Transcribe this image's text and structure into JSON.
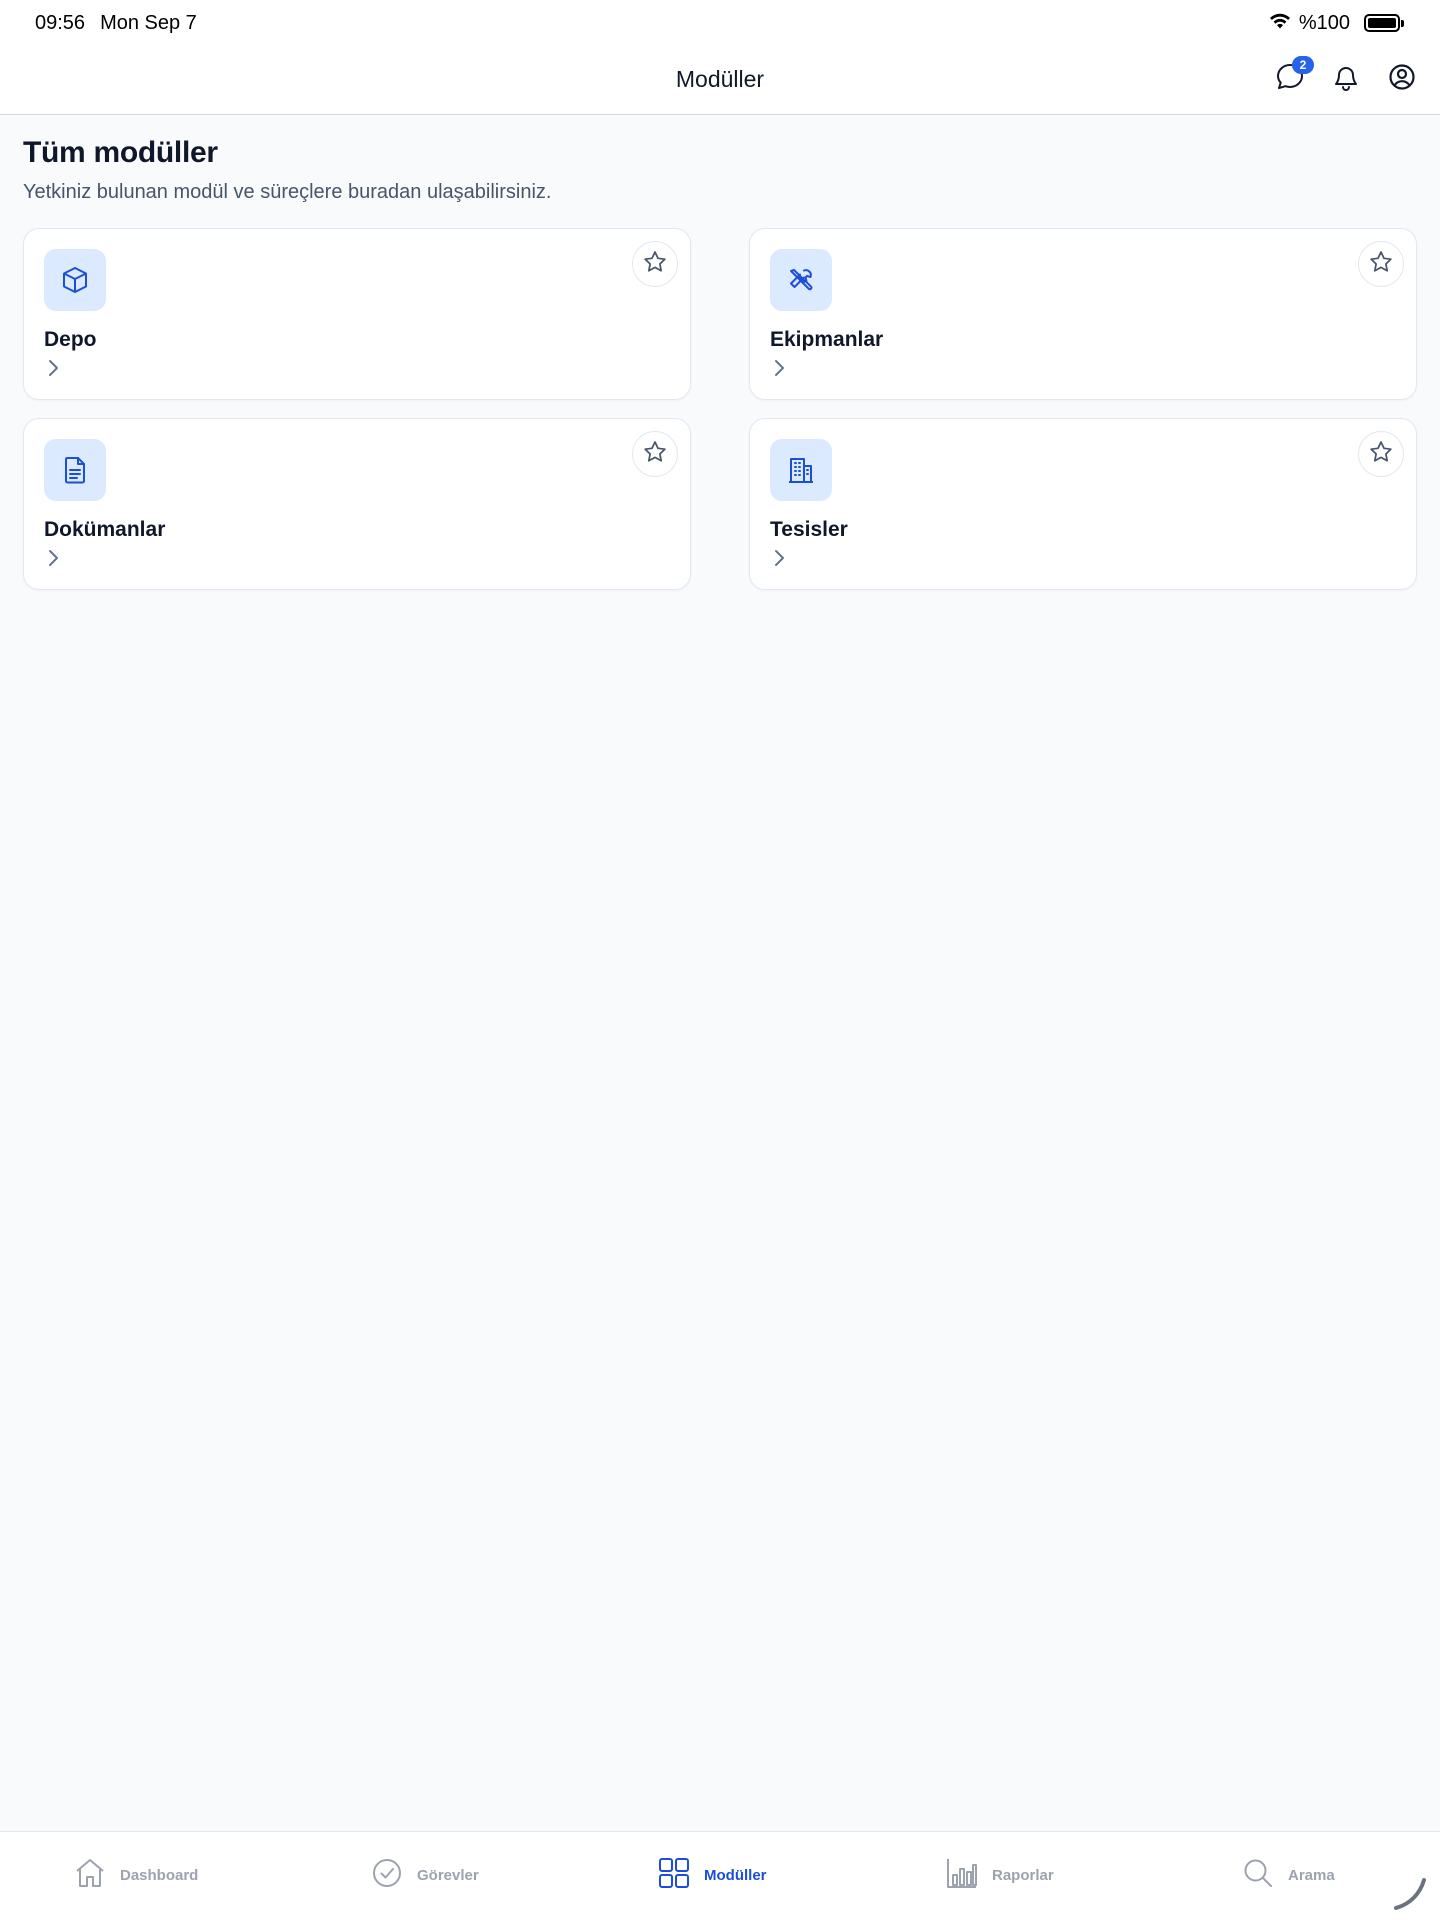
{
  "status_bar": {
    "time": "09:56",
    "date": "Mon Sep 7",
    "battery": "%100"
  },
  "nav": {
    "title": "Modüller",
    "messages_badge": "2",
    "icons": [
      "chat-icon",
      "bell-icon",
      "user-circle-icon"
    ]
  },
  "page": {
    "heading": "Tüm modüller",
    "subtitle": "Yetkiniz bulunan modül ve süreçlere buradan ulaşabilirsiniz."
  },
  "modules": [
    {
      "title": "Depo",
      "icon": "box-icon"
    },
    {
      "title": "Ekipmanlar",
      "icon": "tools-icon"
    },
    {
      "title": "Dokümanlar",
      "icon": "document-icon"
    },
    {
      "title": "Tesisler",
      "icon": "building-icon"
    }
  ],
  "tabs": [
    {
      "label": "Dashboard",
      "icon": "home-icon",
      "active": false
    },
    {
      "label": "Görevler",
      "icon": "check-circle-icon",
      "active": false
    },
    {
      "label": "Modüller",
      "icon": "grid-icon",
      "active": true
    },
    {
      "label": "Raporlar",
      "icon": "bar-chart-icon",
      "active": false
    },
    {
      "label": "Arama",
      "icon": "search-icon",
      "active": false
    }
  ],
  "colors": {
    "accent": "#1d4ed8",
    "icon_bg": "#dbeafe",
    "background": "#f8fafc"
  }
}
